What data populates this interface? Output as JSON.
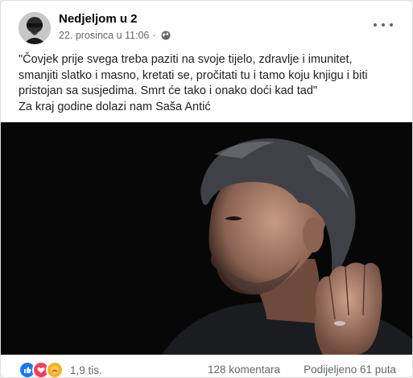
{
  "post": {
    "page_name": "Nedjeljom u 2",
    "date": "22. prosinca u 11:06",
    "separator": "·",
    "privacy_icon": "globe-icon",
    "more_icon": "more-options-icon",
    "text_lines": [
      "\"Čovjek prije svega treba paziti na svoje tijelo, zdravlje i imunitet,",
      "smanjiti slatko i masno, kretati se, pročitati tu i tamo koju knjigu i biti",
      "pristojan sa susjedima. Smrt će tako i onako doći kad tad\"",
      "Za kraj godine dolazi nam Saša Antić"
    ]
  },
  "footer": {
    "reaction_icons": [
      "like-icon",
      "love-icon",
      "care-icon"
    ],
    "reaction_count": "1,9 tis.",
    "comments": "128 komentara",
    "shares": "Podijeljeno 61 puta"
  },
  "colors": {
    "like": "#1877f2",
    "love": "#f33e58",
    "care": "#f7b125",
    "photo_background": "#070707",
    "meta_text": "#65676b"
  }
}
